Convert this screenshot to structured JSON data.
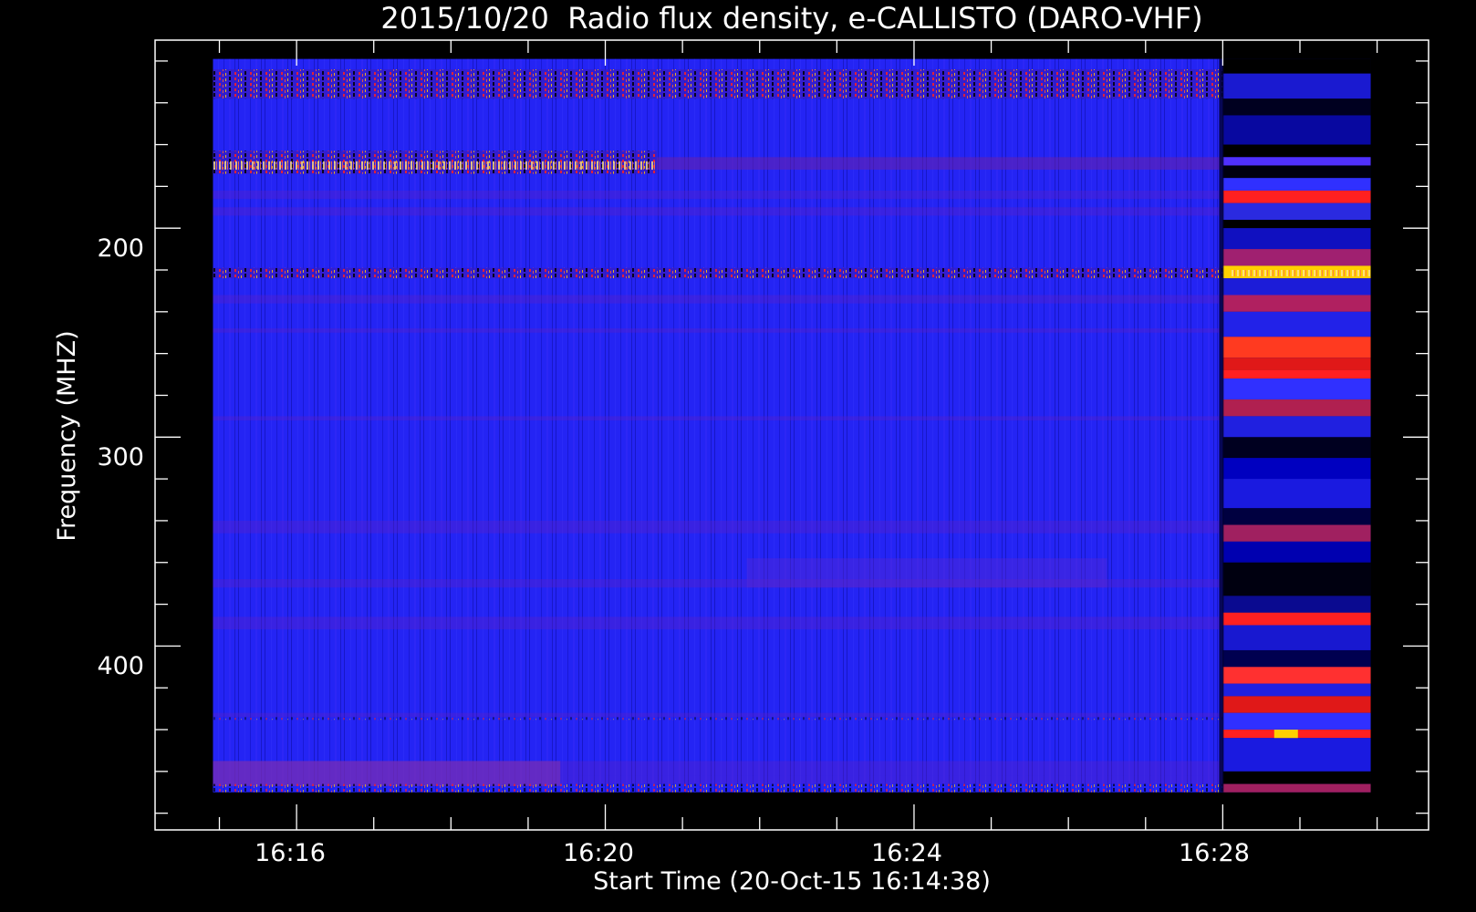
{
  "chart_data": {
    "type": "heatmap",
    "title": "2015/10/20  Radio flux density, e-CALLISTO (DARO-VHF)",
    "xlabel": "Start Time (20-Oct-15 16:14:38)",
    "ylabel": "Frequency (MHZ)",
    "x_axis": {
      "unit": "time (HH:MM)",
      "range": [
        "16:14:10",
        "16:30:40"
      ],
      "data_range": [
        "16:14:55",
        "16:29:55"
      ],
      "major_ticks": [
        "16:16",
        "16:20",
        "16:24",
        "16:28"
      ],
      "minor_tick_interval_minutes": 1
    },
    "y_axis": {
      "unit": "MHz",
      "inverted": true,
      "range": [
        110,
        488
      ],
      "data_range": [
        119,
        470
      ],
      "major_ticks": [
        200,
        300,
        400
      ],
      "minor_tick_interval": 20
    },
    "colormap": [
      "#000000",
      "#0000ff",
      "#ff0000",
      "#ffd000",
      "#ffffff"
    ],
    "features": [
      {
        "label": "interference band",
        "freq_range": [
          124,
          138
        ],
        "time_range": [
          "16:14:55",
          "16:29:55"
        ]
      },
      {
        "label": "interference band",
        "freq_range": [
          163,
          174
        ],
        "time_range": [
          "16:14:55",
          "16:20:40"
        ]
      },
      {
        "label": "interference band",
        "freq_range": [
          219,
          224
        ],
        "time_range": [
          "16:14:55",
          "16:29:55"
        ]
      },
      {
        "label": "enhanced emission onset",
        "time": "16:28:00"
      },
      {
        "label": "banded emission",
        "freq_range": [
          119,
          470
        ],
        "time_range": [
          "16:28:00",
          "16:29:55"
        ]
      }
    ],
    "grid": false,
    "legend": "none"
  }
}
